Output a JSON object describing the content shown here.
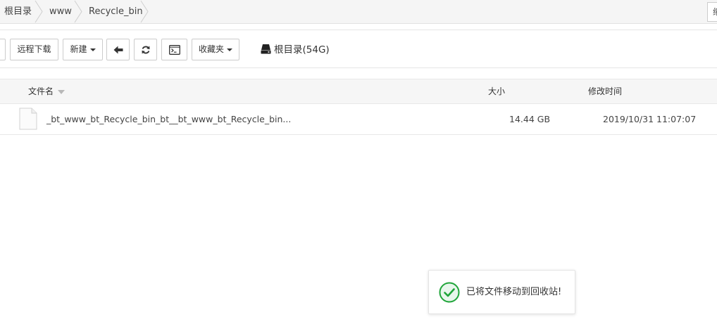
{
  "breadcrumb": {
    "items": [
      "根目录",
      "www",
      "Recycle_bin"
    ],
    "right_glyph": "缩"
  },
  "toolbar": {
    "remote_download_label": "远程下载",
    "new_label": "新建",
    "favorites_label": "收藏夹",
    "disk_label": "根目录(54G)"
  },
  "list": {
    "columns": {
      "name": "文件名",
      "size": "大小",
      "modified": "修改时间"
    },
    "rows": [
      {
        "name": "_bt_www_bt_Recycle_bin_bt__bt_www_bt_Recycle_bin...",
        "size": "14.44 GB",
        "modified": "2019/10/31 11:07:07"
      }
    ]
  },
  "toast": {
    "message": "已将文件移动到回收站!"
  },
  "colors": {
    "success": "#20a53a",
    "success_bg": "#e8f6ec",
    "border": "#cccccc"
  }
}
